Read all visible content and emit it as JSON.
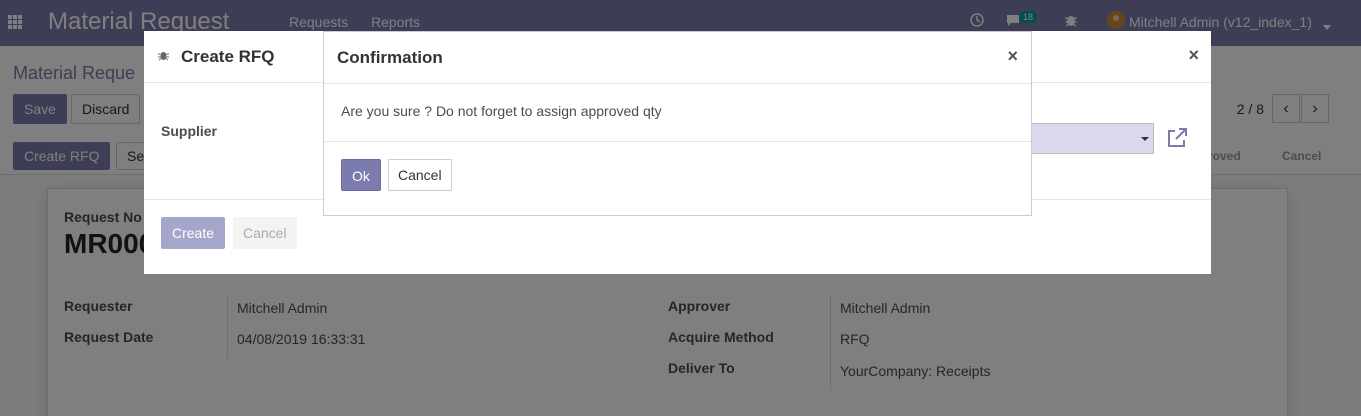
{
  "navbar": {
    "app_title": "Material Request",
    "menu": [
      "Requests",
      "Reports"
    ],
    "messages_count": "18",
    "user": "Mitchell Admin (v12_index_1)"
  },
  "control_panel": {
    "breadcrumb": "Material Reque",
    "save_label": "Save",
    "discard_label": "Discard",
    "pager": "2 / 8"
  },
  "status_bar": {
    "create_rfq_label": "Create RFQ",
    "set_label": "Se",
    "stages": [
      "roved",
      "Cancel"
    ]
  },
  "form": {
    "request_no_label": "Request No",
    "request_no": "MR000",
    "requester_label": "Requester",
    "requester": "Mitchell Admin",
    "request_date_label": "Request Date",
    "request_date": "04/08/2019 16:33:31",
    "approver_label": "Approver",
    "approver": "Mitchell Admin",
    "acquire_method_label": "Acquire Method",
    "acquire_method": "RFQ",
    "deliver_to_label": "Deliver To",
    "deliver_to": "YourCompany: Receipts"
  },
  "rfq_dialog": {
    "title": "Create RFQ",
    "close_glyph": "×",
    "supplier_label": "Supplier",
    "create_label": "Create",
    "cancel_label": "Cancel"
  },
  "confirm_dialog": {
    "title": "Confirmation",
    "close_glyph": "×",
    "message": "Are you sure ? Do not forget to assign approved qty",
    "ok_label": "Ok",
    "cancel_label": "Cancel"
  },
  "colors": {
    "brand": "#7c7bad",
    "overlay": "rgba(0,0,0,0.5)"
  }
}
